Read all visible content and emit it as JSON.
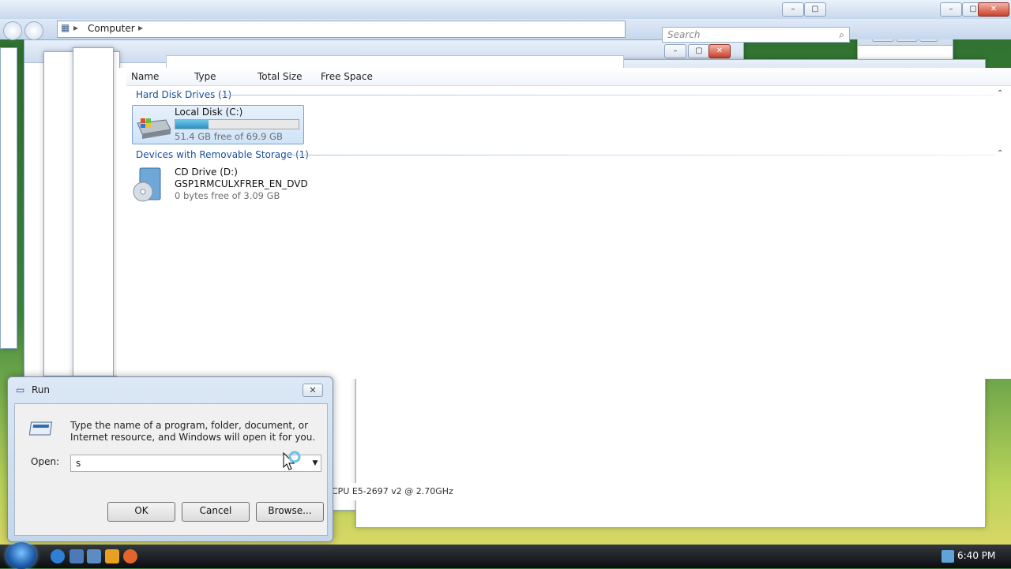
{
  "explorer": {
    "breadcrumb": "Computer",
    "search_placeholder": "Search",
    "columns": [
      "Name",
      "Type",
      "Total Size",
      "Free Space"
    ],
    "groups": [
      {
        "label": "Hard Disk Drives (1)"
      },
      {
        "label": "Devices with Removable Storage (1)"
      }
    ],
    "drives": [
      {
        "name": "Local Disk (C:)",
        "free": "51.4 GB free of 69.9 GB",
        "used_fraction": 0.27
      },
      {
        "name": "CD Drive (D:)",
        "label": "GSP1RMCULXFRER_EN_DVD",
        "free": "0 bytes free of 3.09 GB"
      }
    ],
    "cpu_fragment": "CPU E5-2697 v2 @ 2.70GHz"
  },
  "run": {
    "title": "Run",
    "description": "Type the name of a program, folder, document, or Internet resource, and Windows will open it for you.",
    "open_label": "Open:",
    "open_value": "s",
    "ok_label": "OK",
    "cancel_label": "Cancel",
    "browse_label": "Browse..."
  },
  "taskbar": {
    "clock": "6:40 PM"
  },
  "colors": {
    "group_header": "#1a4e9a",
    "selection": "#cfe3f8",
    "bar_fill": "#2a8fc0"
  }
}
